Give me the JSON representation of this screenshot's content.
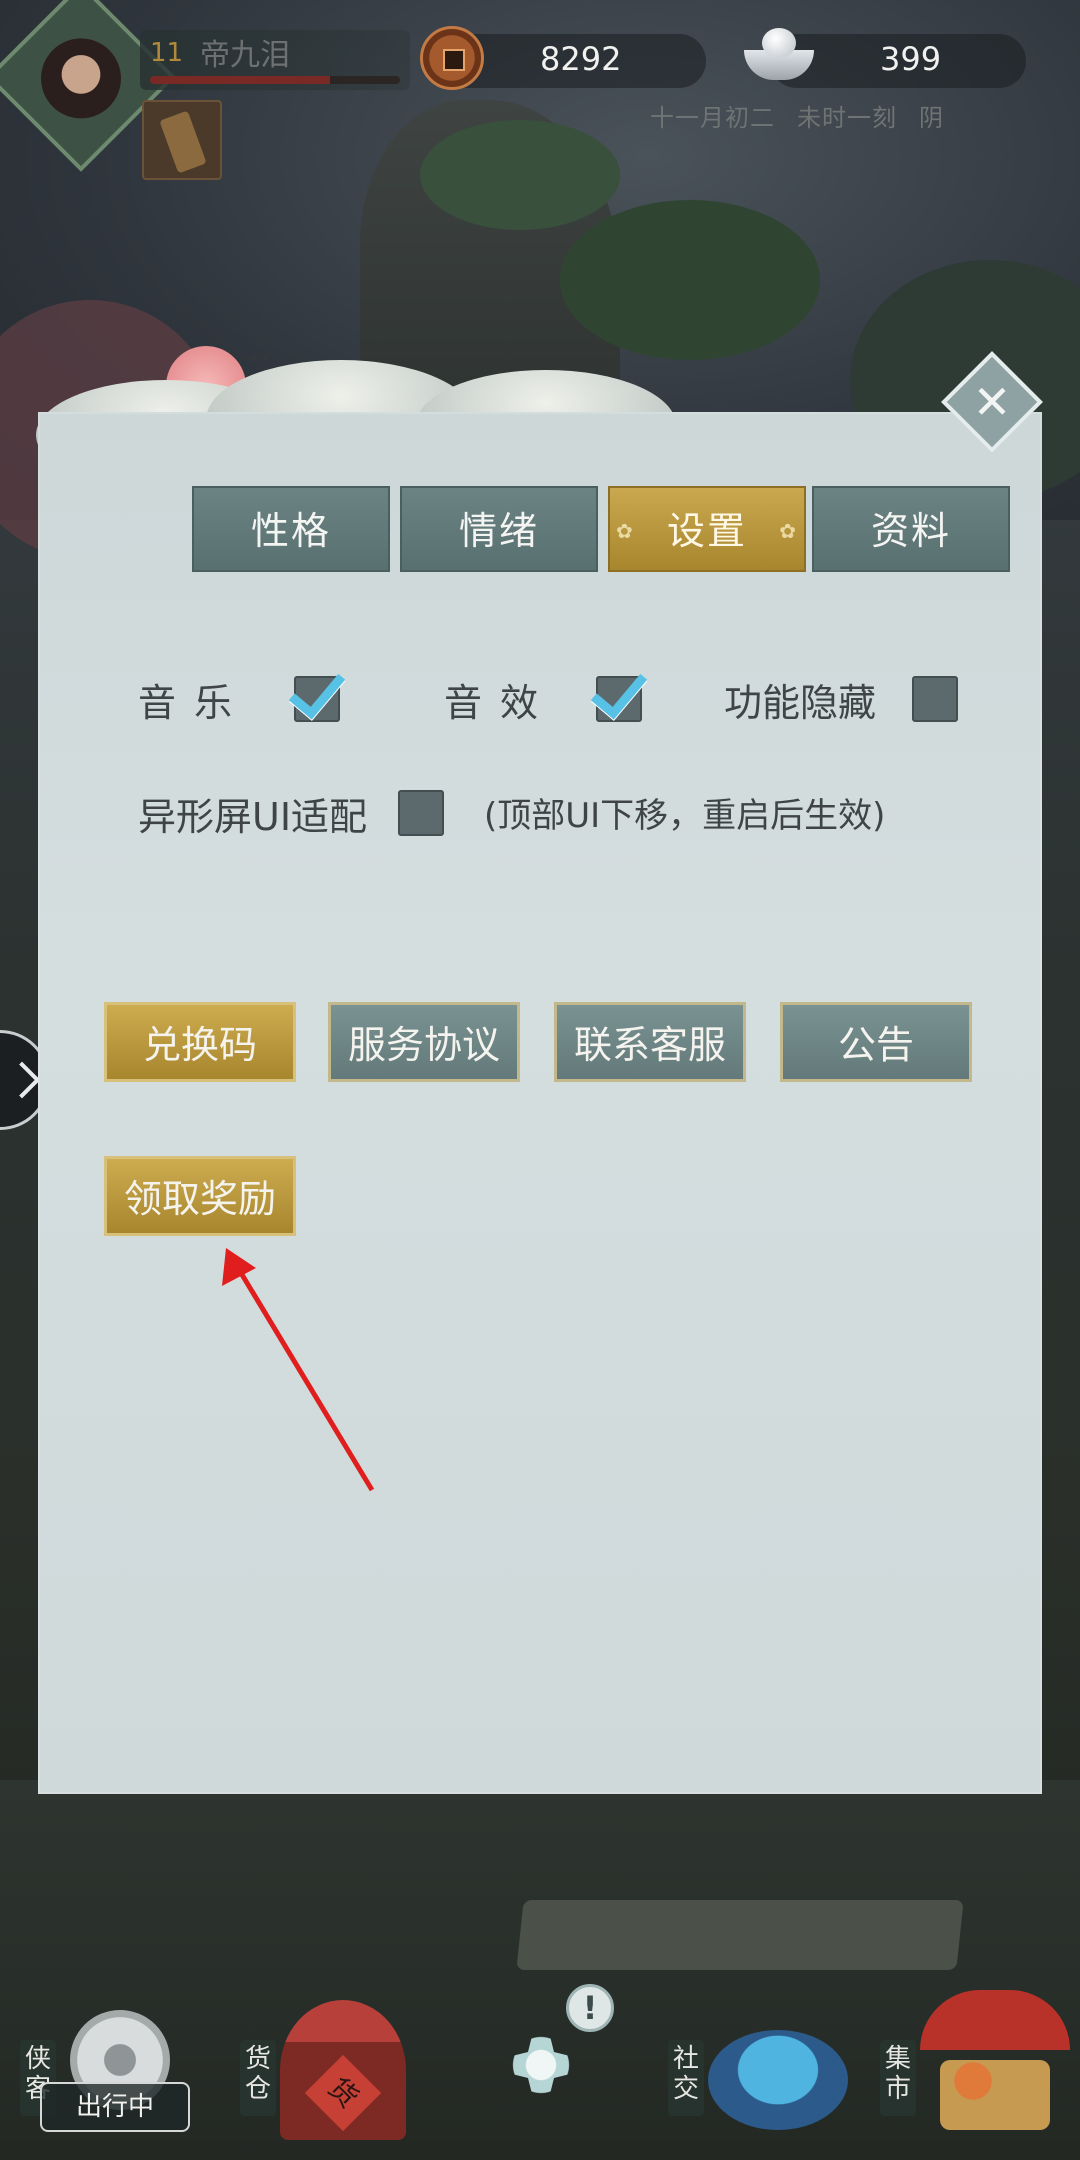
{
  "player": {
    "level": "11",
    "name": "帝九泪",
    "hp_fraction": 0.72
  },
  "currency": {
    "copper": "8292",
    "silver": "399"
  },
  "datetime": {
    "date": "十一月初二",
    "time": "未时一刻",
    "weather": "阴"
  },
  "panel": {
    "close_label": "✕",
    "tabs": [
      {
        "label": "性格",
        "active": false
      },
      {
        "label": "情绪",
        "active": false
      },
      {
        "label": "设置",
        "active": true
      },
      {
        "label": "资料",
        "active": false
      }
    ],
    "settings": {
      "music_label": "音乐",
      "music_checked": true,
      "sfx_label": "音效",
      "sfx_checked": true,
      "hide_label": "功能隐藏",
      "hide_checked": false,
      "notch_label": "异形屏UI适配",
      "notch_checked": false,
      "notch_hint": "(顶部UI下移，重启后生效)"
    },
    "buttons": {
      "redeem": "兑换码",
      "terms": "服务协议",
      "support": "联系客服",
      "notice": "公告",
      "claim_reward": "领取奖励"
    }
  },
  "bottom_nav": {
    "hero_label": "侠客",
    "hero_badge": "出行中",
    "warehouse_label": "货仓",
    "center_alert": "!",
    "social_label": "社交",
    "market_label": "集市"
  },
  "colors": {
    "accent_gold": "#c9a850",
    "tab_teal": "#6c8384",
    "panel_bg": "#d5dedf",
    "check_blue": "#58c1e6",
    "annotation_red": "#e01e1e"
  }
}
